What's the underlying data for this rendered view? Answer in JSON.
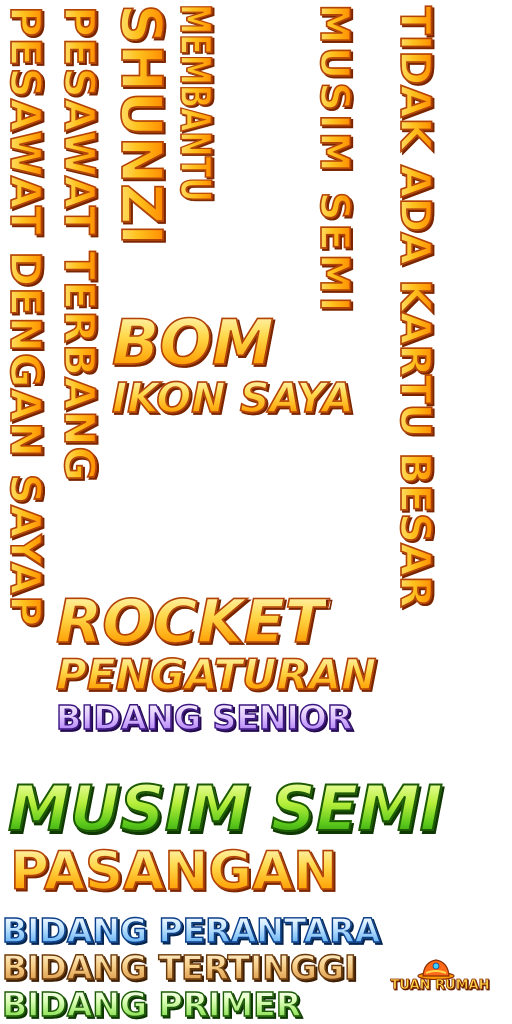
{
  "labels": {
    "pesawat_dengan_sayap": "PESAWAT DENGAN SAYAP",
    "pesawat_terbang": "PESAWAT TERBANG",
    "shunzi": "SHUNZI",
    "membantu": "MEMBANTU",
    "musim_semi_vertical": "MUSIM SEMI",
    "tidak_ada_kartu_besar": "TIDAK ADA KARTU BESAR",
    "bom": "BOM",
    "ikon_saya": "IKON SAYA",
    "rocket": "ROCKET",
    "pengaturan": "PENGATURAN",
    "bidang_senior": "BIDANG SENIOR",
    "musim_semi": "MUSIM SEMI",
    "pasangan": "PASANGAN",
    "bidang_perantara": "BIDANG PERANTARA",
    "bidang_tertinggi": "BIDANG TERTINGGI",
    "bidang_primer": "BIDANG PRIMER"
  },
  "host_badge": {
    "label": "TUAN RUMAH",
    "icon": "crown-hat-icon"
  },
  "colors": {
    "gold": "#ffc21e",
    "gold_outline": "#b3420a",
    "purple": "#a773f5",
    "green": "#58c61a",
    "blue": "#4fa5f0",
    "bronze": "#d69040",
    "lime": "#75d83a"
  }
}
